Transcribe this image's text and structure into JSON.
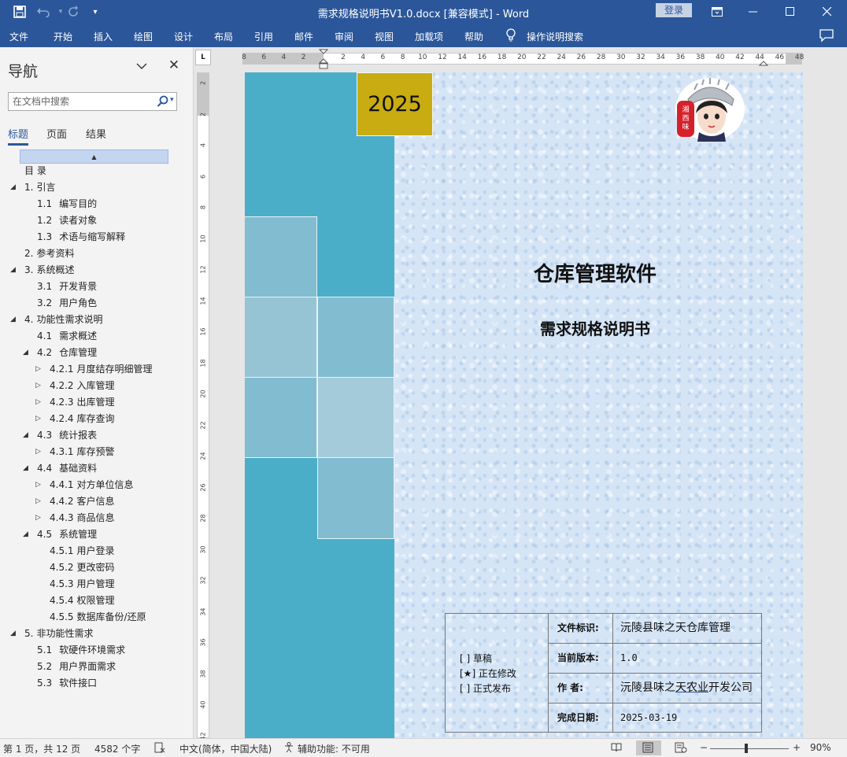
{
  "app": {
    "window_title": "需求规格说明书V1.0.docx [兼容模式]  -  Word",
    "login_label": "登录",
    "qat_save": "save-icon",
    "qat_undo": "undo-icon",
    "qat_redo": "redo-icon"
  },
  "ribbon": {
    "tabs": [
      "文件",
      "开始",
      "插入",
      "绘图",
      "设计",
      "布局",
      "引用",
      "邮件",
      "审阅",
      "视图",
      "加载项",
      "帮助"
    ],
    "tell_me": "操作说明搜索"
  },
  "nav": {
    "title": "导航",
    "search_placeholder": "在文档中搜索",
    "tabs": [
      "标题",
      "页面",
      "结果"
    ],
    "items": [
      {
        "num": "",
        "label": "目  录",
        "level": 0,
        "toggle": ""
      },
      {
        "num": "1.",
        "label": "引言",
        "level": 1,
        "toggle": "expanded"
      },
      {
        "num": "1.1",
        "label": "编写目的",
        "level": 2,
        "toggle": ""
      },
      {
        "num": "1.2",
        "label": "读者对象",
        "level": 2,
        "toggle": ""
      },
      {
        "num": "1.3",
        "label": "术语与缩写解释",
        "level": 2,
        "toggle": ""
      },
      {
        "num": "2.",
        "label": "参考资料",
        "level": 1,
        "toggle": ""
      },
      {
        "num": "3.",
        "label": "系统概述",
        "level": 1,
        "toggle": "expanded"
      },
      {
        "num": "3.1",
        "label": "开发背景",
        "level": 2,
        "toggle": ""
      },
      {
        "num": "3.2",
        "label": "用户角色",
        "level": 2,
        "toggle": ""
      },
      {
        "num": "4.",
        "label": "功能性需求说明",
        "level": 1,
        "toggle": "expanded"
      },
      {
        "num": "4.1",
        "label": "需求概述",
        "level": 2,
        "toggle": ""
      },
      {
        "num": "4.2",
        "label": "仓库管理",
        "level": 2,
        "toggle": "expanded"
      },
      {
        "num": "4.2.1",
        "label": "月度结存明细管理",
        "level": 3,
        "toggle": "collapsed"
      },
      {
        "num": "4.2.2",
        "label": "入库管理",
        "level": 3,
        "toggle": "collapsed"
      },
      {
        "num": "4.2.3",
        "label": "出库管理",
        "level": 3,
        "toggle": "collapsed"
      },
      {
        "num": "4.2.4",
        "label": "库存查询",
        "level": 3,
        "toggle": "collapsed"
      },
      {
        "num": "4.3",
        "label": "统计报表",
        "level": 2,
        "toggle": "expanded"
      },
      {
        "num": "4.3.1",
        "label": "库存预警",
        "level": 3,
        "toggle": "collapsed"
      },
      {
        "num": "4.4",
        "label": "基础资料",
        "level": 2,
        "toggle": "expanded"
      },
      {
        "num": "4.4.1",
        "label": "对方单位信息",
        "level": 3,
        "toggle": "collapsed"
      },
      {
        "num": "4.4.2",
        "label": "客户信息",
        "level": 3,
        "toggle": "collapsed"
      },
      {
        "num": "4.4.3",
        "label": "商品信息",
        "level": 3,
        "toggle": "collapsed"
      },
      {
        "num": "4.5",
        "label": "系统管理",
        "level": 2,
        "toggle": "expanded"
      },
      {
        "num": "4.5.1",
        "label": "用户登录",
        "level": 3,
        "toggle": ""
      },
      {
        "num": "4.5.2",
        "label": "更改密码",
        "level": 3,
        "toggle": ""
      },
      {
        "num": "4.5.3",
        "label": "用户管理",
        "level": 3,
        "toggle": ""
      },
      {
        "num": "4.5.4",
        "label": "权限管理",
        "level": 3,
        "toggle": ""
      },
      {
        "num": "4.5.5",
        "label": "数据库备份/还原",
        "level": 3,
        "toggle": ""
      },
      {
        "num": "5.",
        "label": "非功能性需求",
        "level": 1,
        "toggle": "expanded"
      },
      {
        "num": "5.1",
        "label": "软硬件环境需求",
        "level": 2,
        "toggle": ""
      },
      {
        "num": "5.2",
        "label": "用户界面需求",
        "level": 2,
        "toggle": ""
      },
      {
        "num": "5.3",
        "label": "软件接口",
        "level": 2,
        "toggle": ""
      }
    ]
  },
  "ruler": {
    "corner": "L",
    "h_ticks": [
      "8",
      "6",
      "4",
      "2",
      "",
      "2",
      "4",
      "6",
      "8",
      "10",
      "12",
      "14",
      "16",
      "18",
      "20",
      "22",
      "24",
      "26",
      "28",
      "30",
      "32",
      "34",
      "36",
      "38",
      "40",
      "42",
      "44",
      "46",
      "48"
    ],
    "v_ticks": [
      "2",
      "2",
      "4",
      "6",
      "8",
      "10",
      "12",
      "14",
      "16",
      "18",
      "20",
      "22",
      "24",
      "26",
      "28",
      "30",
      "32",
      "34",
      "36",
      "38",
      "40",
      "42"
    ]
  },
  "document": {
    "year": "2025",
    "title": "仓库管理软件",
    "subtitle": "需求规格说明书",
    "logo": "xiangxi-girl-logo",
    "status_options": [
      "[  ] 草稿",
      "[★] 正在修改",
      "[  ] 正式发布"
    ],
    "info": [
      {
        "key": "文件标识:",
        "value": "沅陵县味之天仓库管理"
      },
      {
        "key": "当前版本:",
        "value": "1.0"
      },
      {
        "key": "作    者:",
        "value_pre": "沅陵县味之",
        "value_ul": "天农业",
        "value_post": "开发公司"
      },
      {
        "key": "完成日期:",
        "value": "2025-03-19"
      }
    ]
  },
  "statusbar": {
    "page": "第 1 页，共 12 页",
    "words": "4582 个字",
    "language": "中文(简体，中国大陆)",
    "accessibility": "辅助功能: 不可用",
    "zoom": "90%",
    "zoom_minus": "−",
    "zoom_plus": "+"
  },
  "colors": {
    "brand": "#2b579a",
    "stripe": "#4aaec8",
    "year_box": "#c8ac12"
  }
}
